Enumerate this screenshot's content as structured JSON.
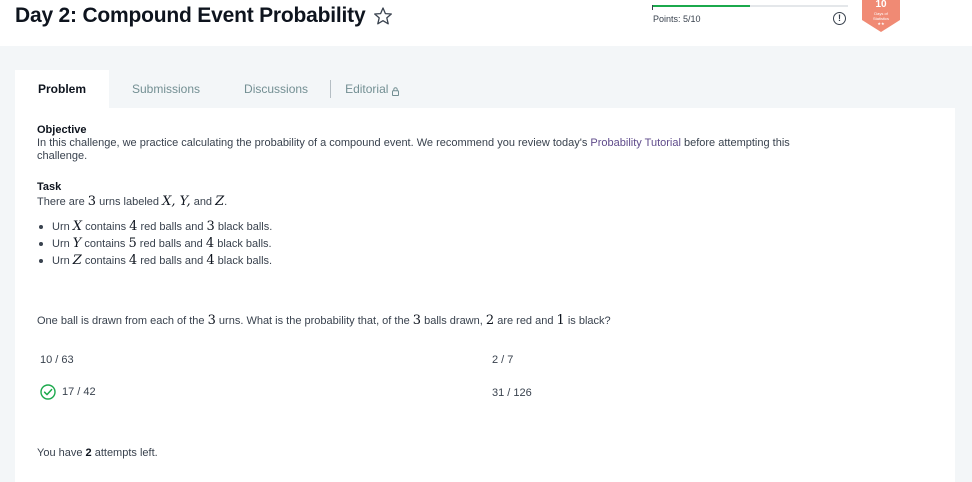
{
  "header": {
    "title": "Day 2: Compound Event Probability",
    "points_label": "Points: 5/10",
    "points_progress": 0.5,
    "badge_number": "10",
    "badge_text_1": "Days of",
    "badge_text_2": "Statistics",
    "badge_stars": "★★"
  },
  "tabs": [
    {
      "label": "Problem"
    },
    {
      "label": "Submissions"
    },
    {
      "label": "Discussions"
    },
    {
      "label": "Editorial"
    }
  ],
  "problem": {
    "objective_heading": "Objective",
    "objective_text_1": "In this challenge, we practice calculating the probability of a compound event. We recommend you review today's ",
    "objective_link": "Probability Tutorial",
    "objective_text_2": " before attempting this",
    "objective_text_3": "challenge.",
    "task_heading": "Task",
    "task_intro_1": "There are ",
    "task_intro_num": "3",
    "task_intro_2": " urns labeled ",
    "task_intro_vars": "X, Y,",
    "task_intro_3": " and ",
    "task_intro_z": "Z",
    "task_intro_4": ".",
    "urns": [
      {
        "urn_label": "Urn ",
        "urn_var": "X",
        "t1": " contains ",
        "red": "4",
        "t2": " red balls and ",
        "black": "3",
        "t3": " black balls."
      },
      {
        "urn_label": "Urn ",
        "urn_var": "Y",
        "t1": " contains ",
        "red": "5",
        "t2": " red balls and ",
        "black": "4",
        "t3": " black balls."
      },
      {
        "urn_label": "Urn ",
        "urn_var": "Z",
        "t1": " contains ",
        "red": "4",
        "t2": " red balls and ",
        "black": "4",
        "t3": " black balls."
      }
    ],
    "question_1": "One ball is drawn from each of the ",
    "question_n1": "3",
    "question_2": " urns. What is the probability that, of the ",
    "question_n2": "3",
    "question_3": " balls drawn, ",
    "question_n3": "2",
    "question_4": " are red and ",
    "question_n4": "1",
    "question_5": " is black?"
  },
  "options": [
    {
      "label": "10 / 63",
      "selected": false
    },
    {
      "label": "2 / 7",
      "selected": false
    },
    {
      "label": "17 / 42",
      "selected": true
    },
    {
      "label": "31 / 126",
      "selected": false
    }
  ],
  "attempts": {
    "prefix": "You have ",
    "count": "2",
    "suffix": " attempts left."
  },
  "colors": {
    "accent_green": "#1ba94c",
    "link_purple": "#5f4b8b",
    "badge_orange": "#f08a74"
  }
}
